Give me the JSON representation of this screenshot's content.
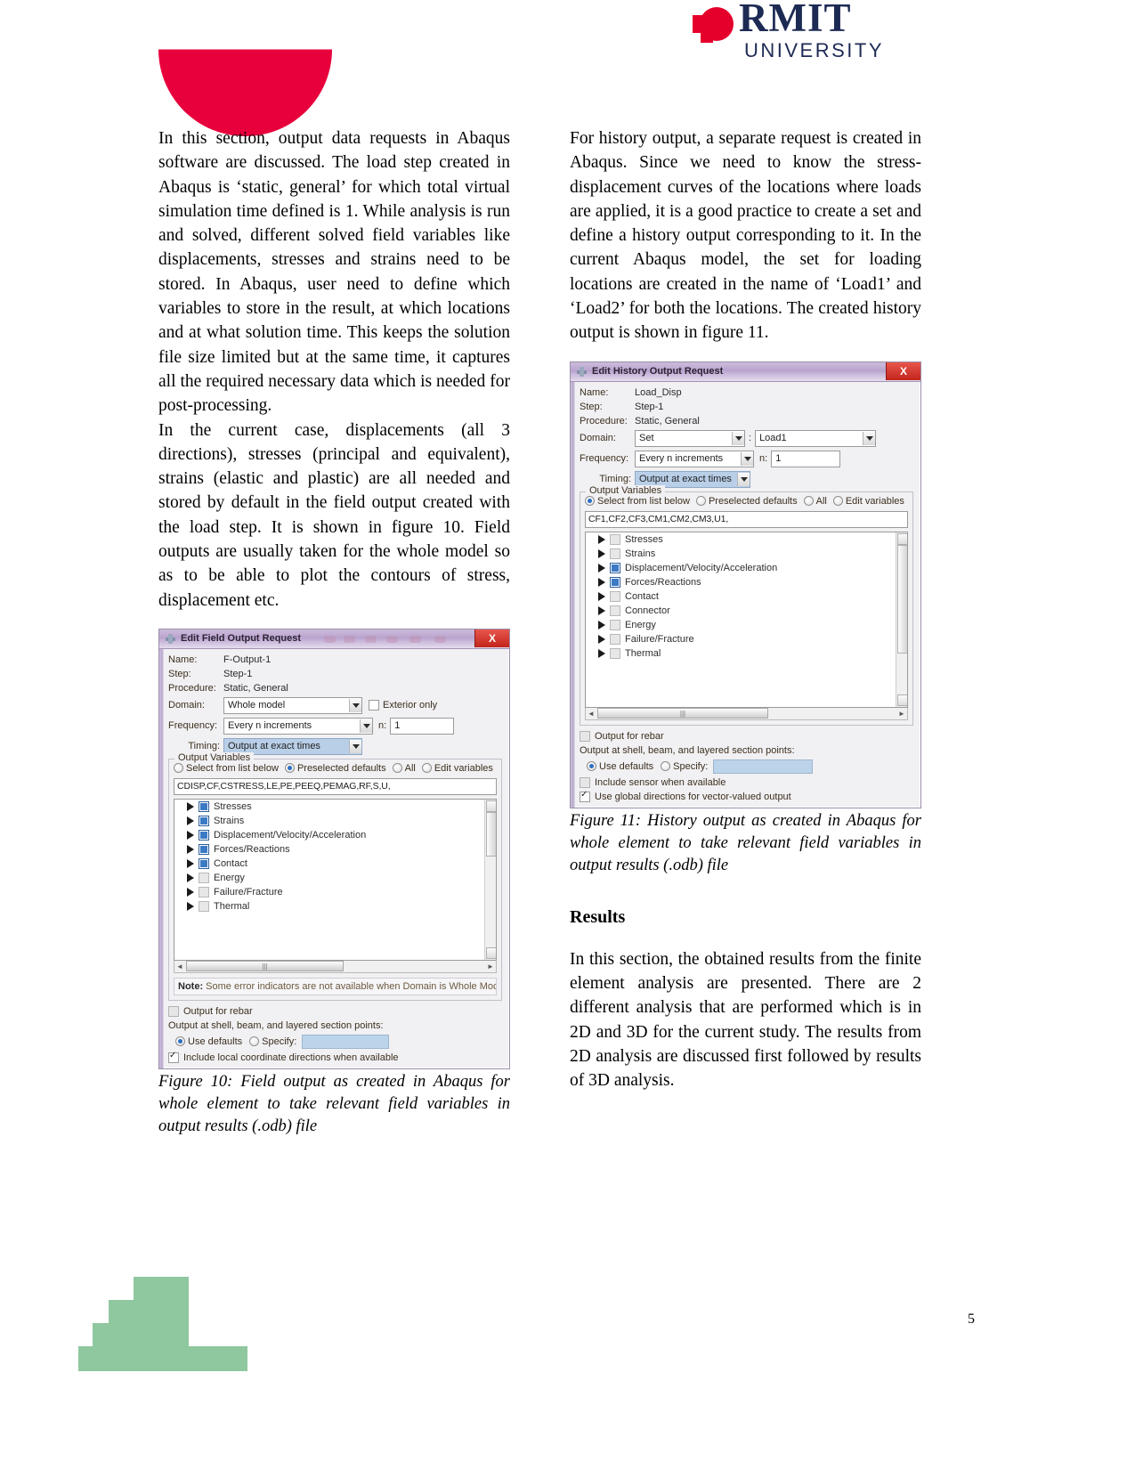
{
  "header": {
    "logo": {
      "wordmark": "RMIT",
      "subtitle": "UNIVERSITY",
      "mark_color": "#e4002b",
      "text_color": "#1d2a54"
    },
    "banner_shape_color": "#e8003c"
  },
  "footer": {
    "page_number": "5",
    "steps_color": "#8fc79f"
  },
  "left_column": {
    "paragraph_1": "In this section, output data requests in Abaqus software are discussed. The load step created in Abaqus is ‘static, general’ for which total virtual simulation time defined is 1. While analysis is run and solved, different solved field variables like displacements, stresses and strains need to be stored. In Abaqus, user need to define which variables to store in the result, at which locations and at what solution time. This keeps the solution file size limited but at the same time, it captures all the required necessary data which is needed for post-processing.",
    "paragraph_2": "In the current case, displacements (all 3 directions), stresses (principal and equivalent), strains (elastic and plastic) are all needed and stored by default in the field output created with the load step. It is shown in figure 10. Field outputs are usually taken for the whole model so as to be able to plot the contours of stress, displacement etc.",
    "figure_caption": "Figure 10: Field output as created in Abaqus for whole element to take relevant field variables in output results (.odb) file"
  },
  "right_column": {
    "paragraph_1": "For history output, a separate request is created in Abaqus. Since we need to know the stress-displacement curves of the locations where loads are applied, it is a good practice to create a set and define a history output corresponding to it. In the current Abaqus model, the set for loading locations are created in the name of ‘Load1’ and ‘Load2’ for both the locations. The created history output is shown in figure 11.",
    "figure_caption": "Figure 11: History output as created in Abaqus for whole element to take relevant field variables in output results (.odb) file",
    "results_heading": "Results",
    "results_paragraph": "In this section, the obtained results from the finite element analysis are presented. There are 2 different analysis that are performed which is in 2D and 3D for the current study. The results from 2D analysis are discussed first followed by results of 3D analysis."
  },
  "field_output_dialog": {
    "title": "Edit Field Output Request",
    "close_label": "X",
    "name_label": "Name:",
    "name_value": "F-Output-1",
    "step_label": "Step:",
    "step_value": "Step-1",
    "procedure_label": "Procedure:",
    "procedure_value": "Static, General",
    "domain_label": "Domain:",
    "domain_value": "Whole model",
    "exterior_only_label": "Exterior only",
    "frequency_label": "Frequency:",
    "frequency_value": "Every n increments",
    "n_label": "n:",
    "n_value": "1",
    "timing_label": "Timing:",
    "timing_value": "Output at exact times",
    "output_variables_group": "Output Variables",
    "radio_select_from_list": "Select from list below",
    "radio_preselected_defaults": "Preselected defaults",
    "radio_all": "All",
    "radio_edit_variables": "Edit variables",
    "selected_radio": "Preselected defaults",
    "variables_value": "CDISP,CF,CSTRESS,LE,PE,PEEQ,PEMAG,RF,S,U,",
    "tree_items": [
      {
        "label": "Stresses",
        "state": "filled"
      },
      {
        "label": "Strains",
        "state": "filled"
      },
      {
        "label": "Displacement/Velocity/Acceleration",
        "state": "filled"
      },
      {
        "label": "Forces/Reactions",
        "state": "filled"
      },
      {
        "label": "Contact",
        "state": "filled"
      },
      {
        "label": "Energy",
        "state": "empty"
      },
      {
        "label": "Failure/Fracture",
        "state": "empty"
      },
      {
        "label": "Thermal",
        "state": "empty"
      }
    ],
    "note_prefix": "Note:",
    "note_text": "Some error indicators are not available when Domain is Whole Model or",
    "output_for_rebar_label": "Output for rebar",
    "section_points_label": "Output at shell, beam, and layered section points:",
    "use_defaults_label": "Use defaults",
    "specify_label": "Specify:",
    "include_local_label": "Include local coordinate directions when available"
  },
  "history_output_dialog": {
    "title": "Edit History Output Request",
    "close_label": "X",
    "name_label": "Name:",
    "name_value": "Load_Disp",
    "step_label": "Step:",
    "step_value": "Step-1",
    "procedure_label": "Procedure:",
    "procedure_value": "Static, General",
    "domain_label": "Domain:",
    "domain_value": "Set",
    "domain_separator": ":",
    "domain_set_value": "Load1",
    "frequency_label": "Frequency:",
    "frequency_value": "Every n increments",
    "n_label": "n:",
    "n_value": "1",
    "timing_label": "Timing:",
    "timing_value": "Output at exact times",
    "output_variables_group": "Output Variables",
    "radio_select_from_list": "Select from list below",
    "radio_preselected_defaults": "Preselected defaults",
    "radio_all": "All",
    "radio_edit_variables": "Edit variables",
    "selected_radio": "Select from list below",
    "variables_value": "CF1,CF2,CF3,CM1,CM2,CM3,U1,",
    "tree_items": [
      {
        "label": "Stresses",
        "state": "empty"
      },
      {
        "label": "Strains",
        "state": "empty"
      },
      {
        "label": "Displacement/Velocity/Acceleration",
        "state": "filled"
      },
      {
        "label": "Forces/Reactions",
        "state": "filled"
      },
      {
        "label": "Contact",
        "state": "empty"
      },
      {
        "label": "Connector",
        "state": "empty"
      },
      {
        "label": "Energy",
        "state": "empty"
      },
      {
        "label": "Failure/Fracture",
        "state": "empty"
      },
      {
        "label": "Thermal",
        "state": "empty"
      }
    ],
    "output_for_rebar_label": "Output for rebar",
    "section_points_label": "Output at shell, beam, and layered section points:",
    "use_defaults_label": "Use defaults",
    "specify_label": "Specify:",
    "include_sensor_label": "Include sensor when available",
    "use_global_label": "Use global directions for vector-valued output"
  }
}
